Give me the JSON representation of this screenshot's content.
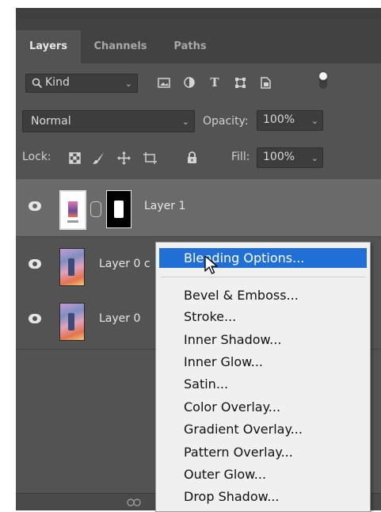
{
  "panel": {
    "tabs": [
      {
        "label": "Layers",
        "active": true
      },
      {
        "label": "Channels",
        "active": false
      },
      {
        "label": "Paths",
        "active": false
      }
    ],
    "filter": {
      "label": "Kind"
    },
    "blend_mode": "Normal",
    "opacity": {
      "label": "Opacity:",
      "value": "100%"
    },
    "lock": {
      "label": "Lock:"
    },
    "fill": {
      "label": "Fill:",
      "value": "100%"
    },
    "layers": [
      {
        "name": "Layer 1",
        "selected": true,
        "has_mask": true
      },
      {
        "name": "Layer 0 c",
        "selected": false,
        "has_mask": false
      },
      {
        "name": "Layer 0",
        "selected": false,
        "has_mask": false
      }
    ]
  },
  "context_menu": {
    "items": [
      {
        "label": "Blending Options...",
        "highlighted": true
      },
      {
        "label": "Bevel & Emboss...",
        "highlighted": false
      },
      {
        "label": "Stroke...",
        "highlighted": false
      },
      {
        "label": "Inner Shadow...",
        "highlighted": false
      },
      {
        "label": "Inner Glow...",
        "highlighted": false
      },
      {
        "label": "Satin...",
        "highlighted": false
      },
      {
        "label": "Color Overlay...",
        "highlighted": false
      },
      {
        "label": "Gradient Overlay...",
        "highlighted": false
      },
      {
        "label": "Pattern Overlay...",
        "highlighted": false
      },
      {
        "label": "Outer Glow...",
        "highlighted": false
      },
      {
        "label": "Drop Shadow...",
        "highlighted": false
      }
    ]
  },
  "colors": {
    "panel_bg": "#535353",
    "selected_layer_bg": "#6a6a6a",
    "menu_highlight": "#1f6fd6",
    "menu_bg": "#f0f0f0"
  }
}
